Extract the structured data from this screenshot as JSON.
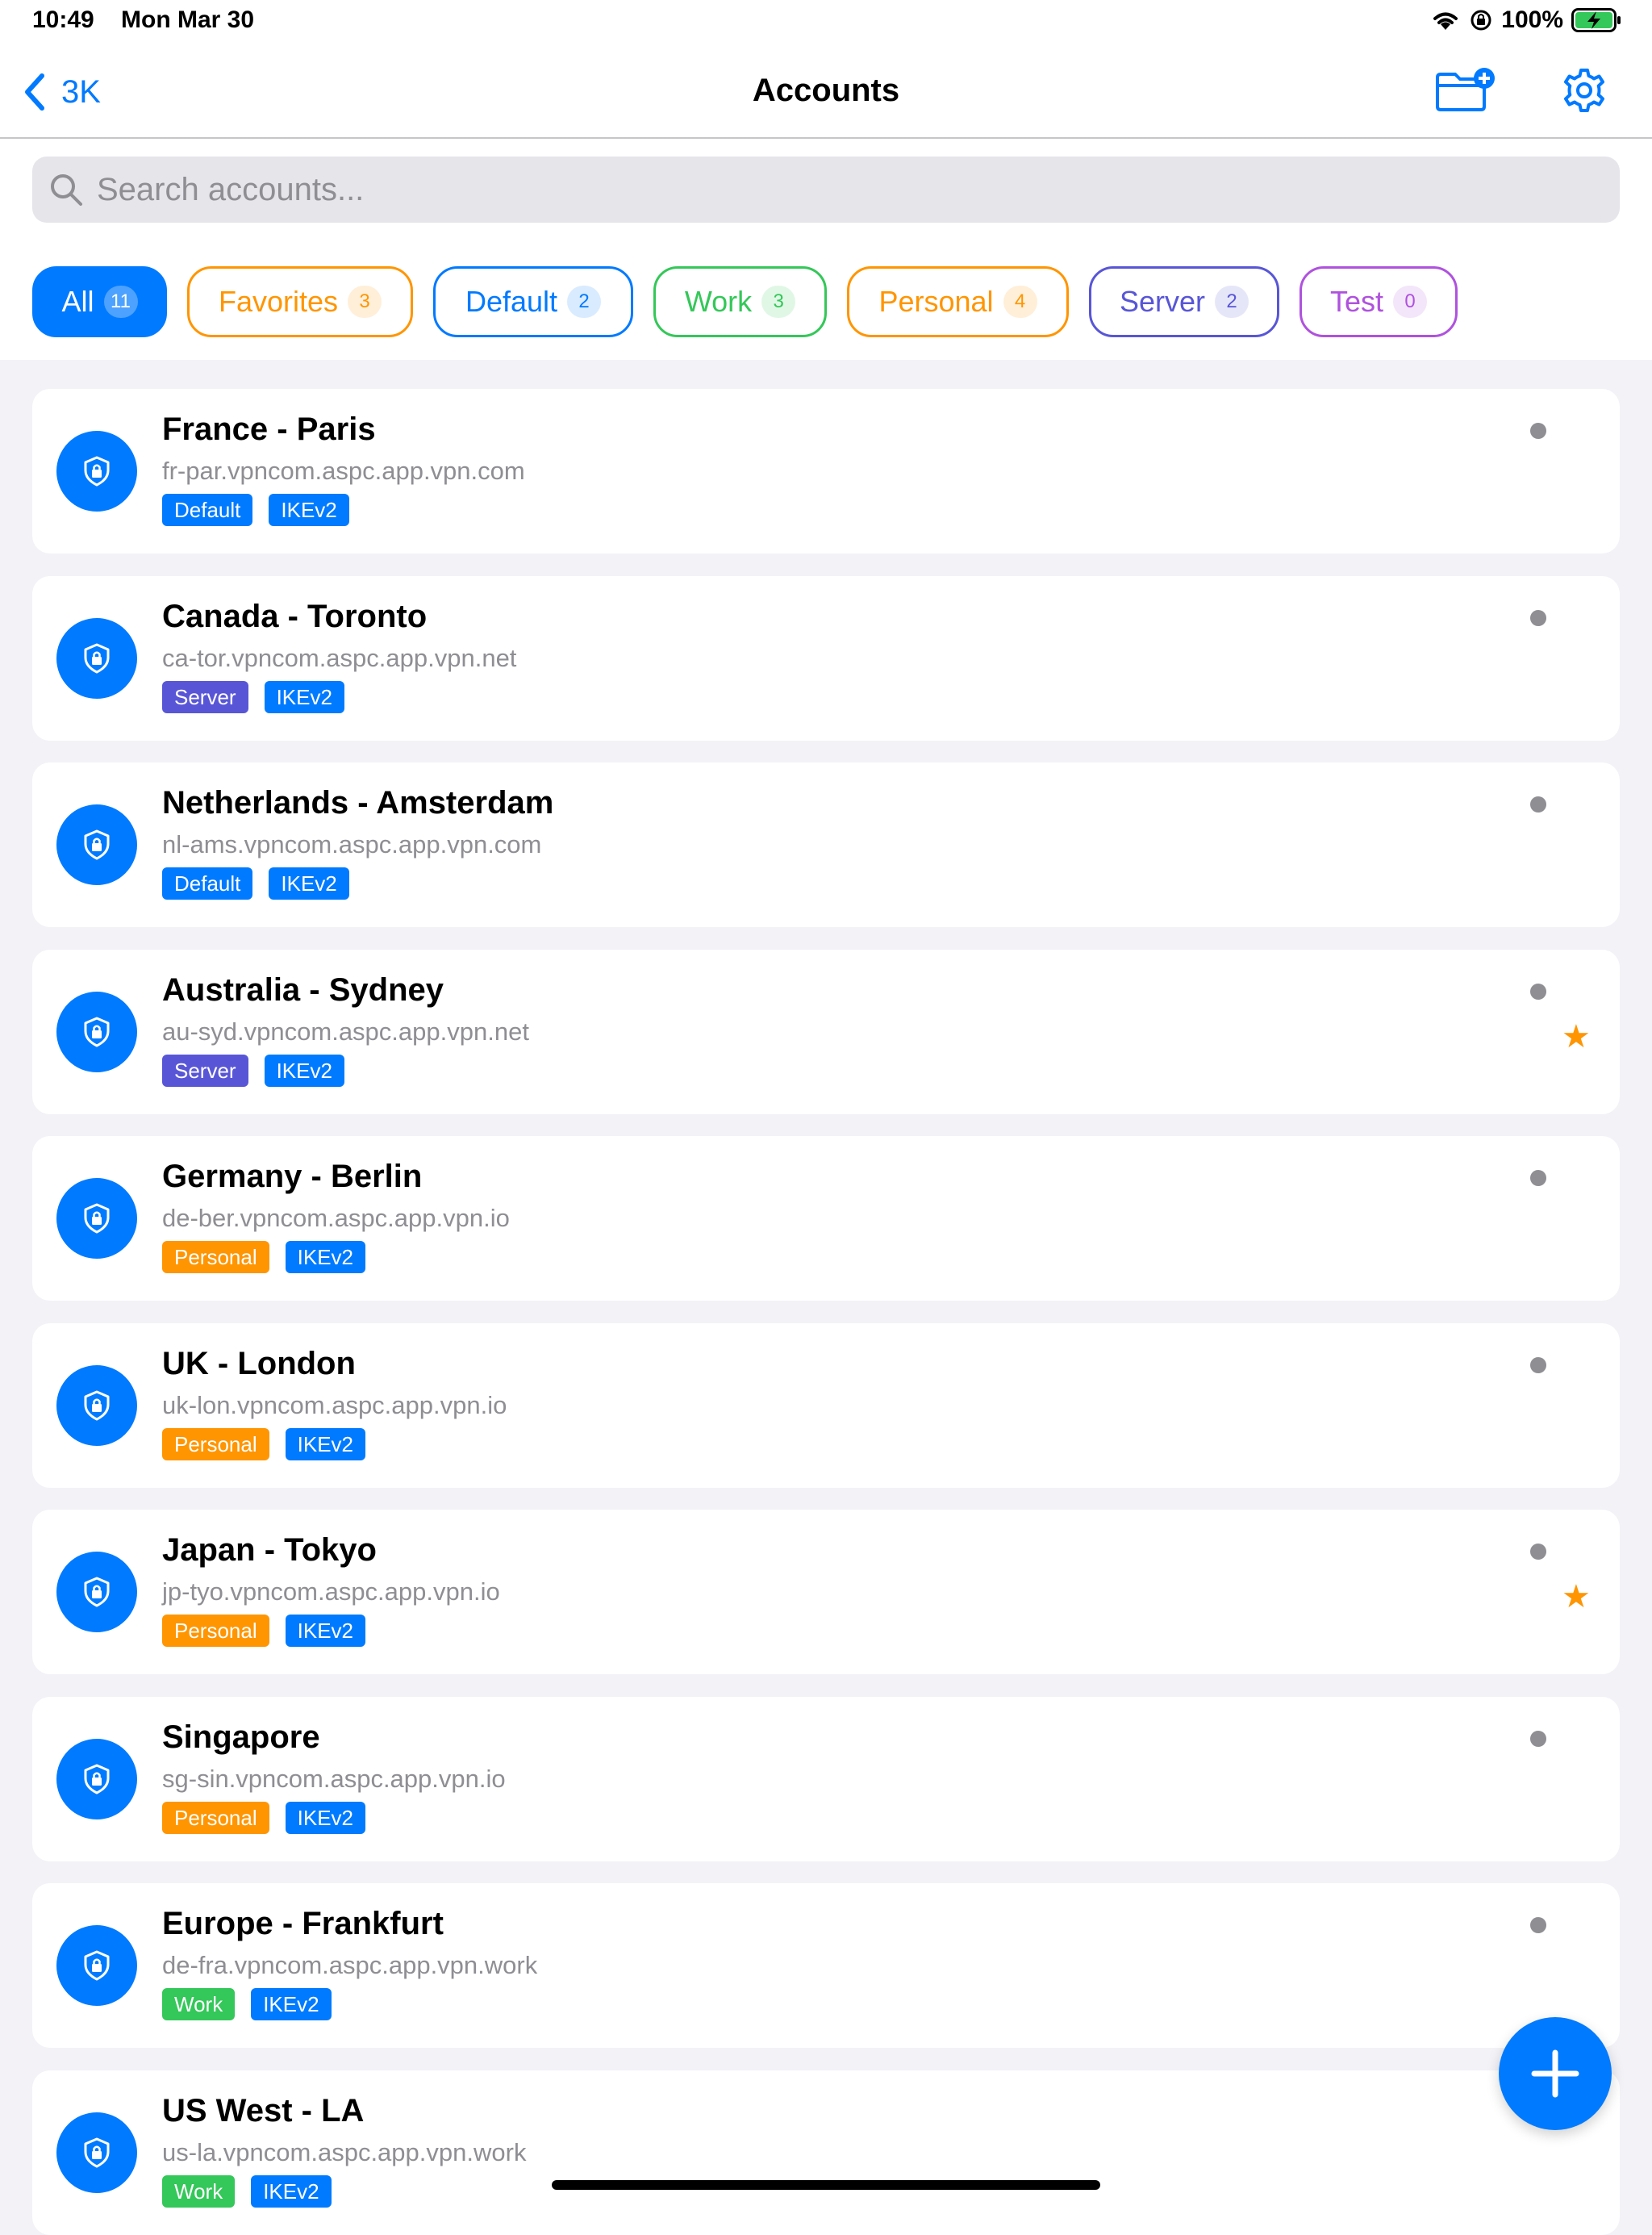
{
  "status_bar": {
    "time": "10:49",
    "date": "Mon Mar 30",
    "battery": "100%"
  },
  "nav": {
    "back_label": "3K",
    "title": "Accounts"
  },
  "search": {
    "placeholder": "Search accounts..."
  },
  "filters": [
    {
      "label": "All",
      "count": "11",
      "color": "#007aff",
      "active": true
    },
    {
      "label": "Favorites",
      "count": "3",
      "color": "#ff9500"
    },
    {
      "label": "Default",
      "count": "2",
      "color": "#007aff"
    },
    {
      "label": "Work",
      "count": "3",
      "color": "#34c759"
    },
    {
      "label": "Personal",
      "count": "4",
      "color": "#ff9500"
    },
    {
      "label": "Server",
      "count": "2",
      "color": "#5856d6"
    },
    {
      "label": "Test",
      "count": "0",
      "color": "#af52de"
    }
  ],
  "tag_colors": {
    "Default": "#007aff",
    "Server": "#5856d6",
    "Personal": "#ff9500",
    "Work": "#34c759",
    "IKEv2": "#007aff"
  },
  "accounts": [
    {
      "name": "France - Paris",
      "host": "fr-par.vpncom.aspc.app.vpn.com",
      "group": "Default",
      "protocol": "IKEv2",
      "favorite": false
    },
    {
      "name": "Canada - Toronto",
      "host": "ca-tor.vpncom.aspc.app.vpn.net",
      "group": "Server",
      "protocol": "IKEv2",
      "favorite": false
    },
    {
      "name": "Netherlands - Amsterdam",
      "host": "nl-ams.vpncom.aspc.app.vpn.com",
      "group": "Default",
      "protocol": "IKEv2",
      "favorite": false
    },
    {
      "name": "Australia - Sydney",
      "host": "au-syd.vpncom.aspc.app.vpn.net",
      "group": "Server",
      "protocol": "IKEv2",
      "favorite": true
    },
    {
      "name": "Germany - Berlin",
      "host": "de-ber.vpncom.aspc.app.vpn.io",
      "group": "Personal",
      "protocol": "IKEv2",
      "favorite": false
    },
    {
      "name": "UK - London",
      "host": "uk-lon.vpncom.aspc.app.vpn.io",
      "group": "Personal",
      "protocol": "IKEv2",
      "favorite": false
    },
    {
      "name": "Japan - Tokyo",
      "host": "jp-tyo.vpncom.aspc.app.vpn.io",
      "group": "Personal",
      "protocol": "IKEv2",
      "favorite": true
    },
    {
      "name": "Singapore",
      "host": "sg-sin.vpncom.aspc.app.vpn.io",
      "group": "Personal",
      "protocol": "IKEv2",
      "favorite": false
    },
    {
      "name": "Europe - Frankfurt",
      "host": "de-fra.vpncom.aspc.app.vpn.work",
      "group": "Work",
      "protocol": "IKEv2",
      "favorite": false
    },
    {
      "name": "US West - LA",
      "host": "us-la.vpncom.aspc.app.vpn.work",
      "group": "Work",
      "protocol": "IKEv2",
      "favorite": false
    }
  ],
  "icons": {
    "back": "chevron-left-icon",
    "new_folder": "folder-plus-icon",
    "settings": "gear-icon",
    "search": "magnifier-icon",
    "account": "shield-lock-icon",
    "favorite": "star-icon",
    "add": "plus-icon"
  }
}
